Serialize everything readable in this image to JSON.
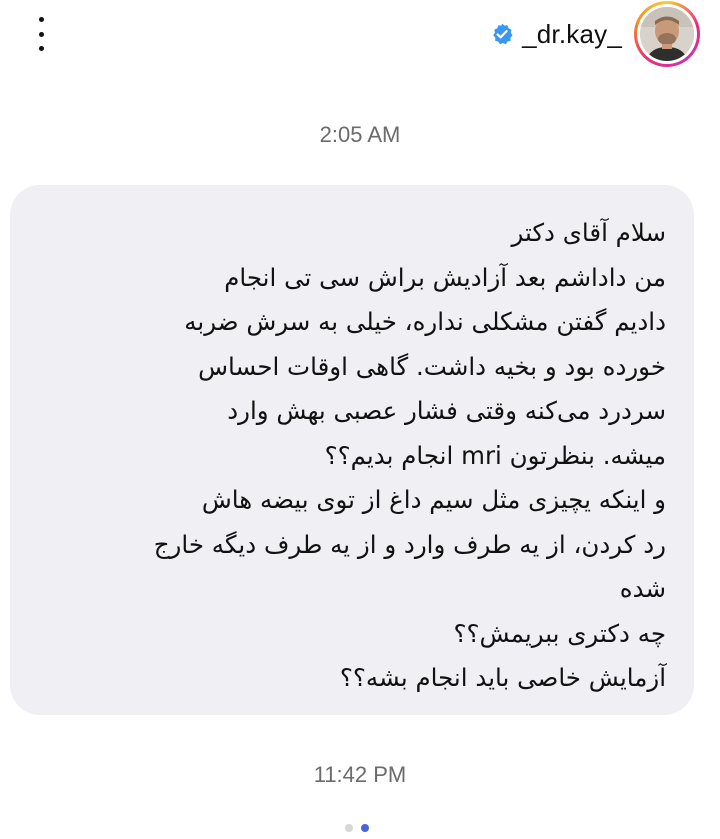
{
  "header": {
    "username": "_dr.kay_",
    "verified": true,
    "icons": {
      "more": "more-vertical-icon",
      "verified": "verified-badge-icon"
    },
    "colors": {
      "verified_badge": "#3897f0"
    }
  },
  "thread": {
    "timestamp_1": "2:05 AM",
    "timestamp_2": "11:42 PM"
  },
  "message": {
    "lines": [
      "سلام آقای دکتر",
      "من داداشم بعد آزادیش براش سی تی انجام",
      "دادیم گفتن مشکلی نداره، خیلی به سرش ضربه",
      "خورده بود و بخیه داشت. گاهی اوقات احساس",
      "سردرد می‌کنه وقتی فشار عصبی بهش وارد",
      "میشه. بنظرتون mri انجام بدیم؟؟",
      "و اینکه یچیزی مثل سیم داغ از توی بیضه هاش",
      "رد کردن، از یه طرف وارد و از یه طرف دیگه خارج",
      "شده",
      "چه دکتری ببریمش؟؟",
      "آزمایش خاصی باید انجام بشه؟؟"
    ],
    "bubble_color": "#efeff4"
  },
  "pager": {
    "count": 2,
    "active_index": 1
  }
}
